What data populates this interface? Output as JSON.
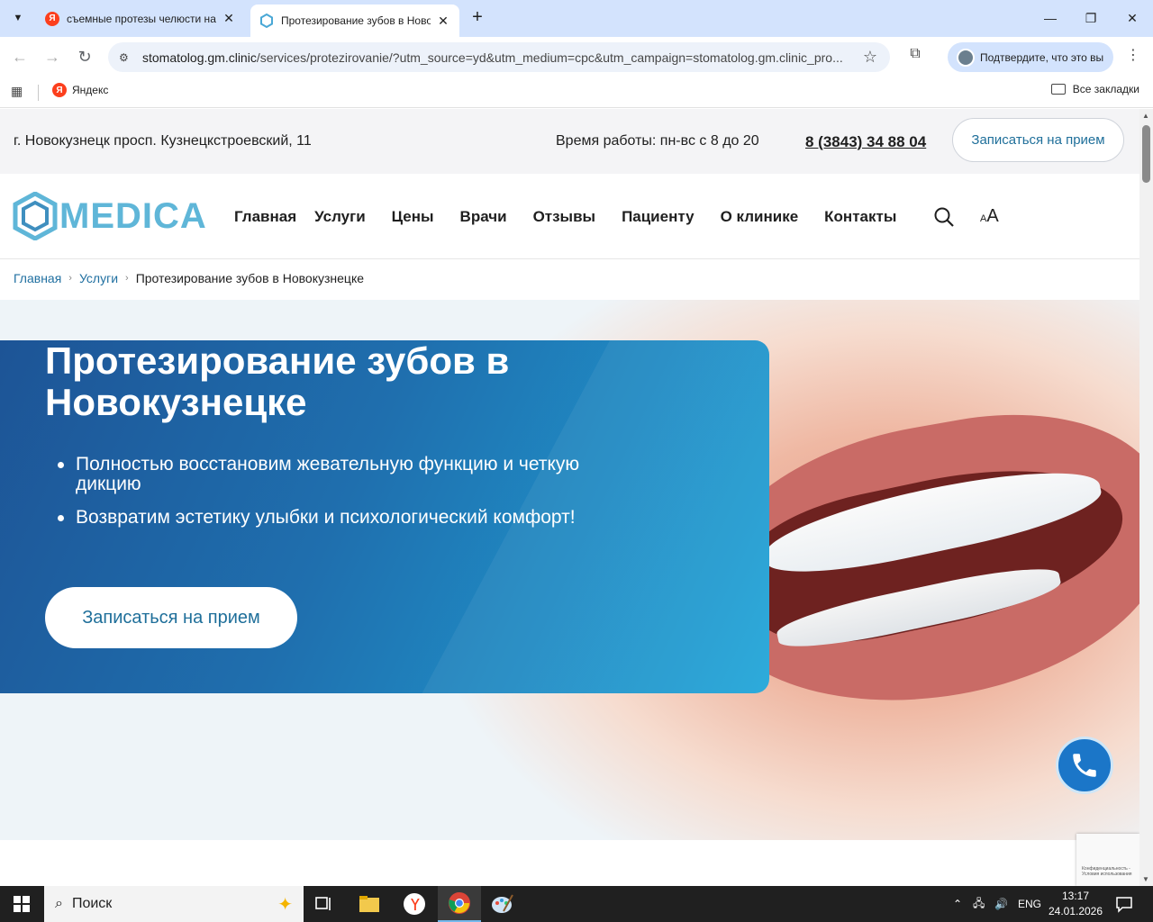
{
  "browser": {
    "tabs": [
      {
        "title": "съемные протезы челюсти на",
        "active": false,
        "favicon": "yandex-icon"
      },
      {
        "title": "Протезирование зубов в Новок",
        "active": true,
        "favicon": "clinic-icon"
      }
    ],
    "url_host": "stomatolog.gm.clinic",
    "url_rest": "/services/protezirovanie/?utm_source=yd&utm_medium=cpc&utm_campaign=stomatolog.gm.clinic_pro...",
    "profile_label": "Подтвердите, что это вы",
    "bookmarks": [
      {
        "label": "Яндекс"
      }
    ],
    "all_bookmarks_label": "Все закладки"
  },
  "topbar": {
    "address": "г. Новокузнецк просп. Кузнецкстроевский, 11",
    "hours": "Время работы: пн-вс с 8 до 20",
    "phone": "8 (3843) 34 88 04",
    "book_label": "Записаться на прием"
  },
  "header": {
    "logo_text": "MEDICA",
    "menu": [
      "Главная",
      "Услуги",
      "Цены",
      "Врачи",
      "Отзывы",
      "Пациенту",
      "О клинике",
      "Контакты"
    ],
    "font_size_label_small": "A",
    "font_size_label_large": "A"
  },
  "breadcrumbs": {
    "items": [
      "Главная",
      "Услуги"
    ],
    "current": "Протезирование зубов в Новокузнецке"
  },
  "hero": {
    "title": "Протезирование зубов в Новокузнецке",
    "bullets": [
      "Полностью восстановим жевательную функцию и четкую дикцию",
      "Возвратим эстетику улыбки и психологический комфорт!"
    ],
    "button_label": "Записаться на прием"
  },
  "recaptcha_text": "Конфиденциальность - Условия использования",
  "taskbar": {
    "search_placeholder": "Поиск",
    "lang": "ENG",
    "time": "13:17",
    "date": "24.01.2026"
  },
  "colors": {
    "accent": "#1f6f9a",
    "hero_gradient_start": "#1d5496",
    "hero_gradient_end": "#20a6d9",
    "logo": "#5fb6d8"
  }
}
